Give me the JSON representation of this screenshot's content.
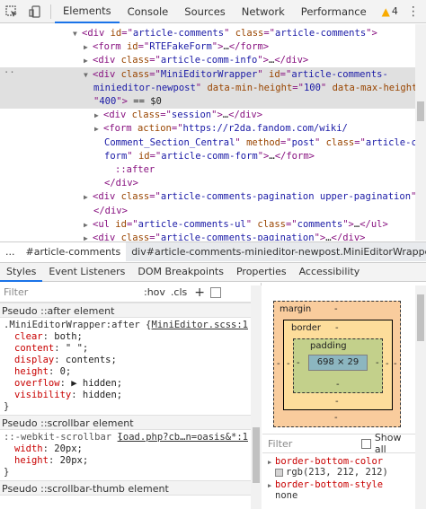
{
  "topbar": {
    "tabs": [
      "Elements",
      "Console",
      "Sources",
      "Network",
      "Performance"
    ],
    "active_tab": "Elements",
    "warning_count": "4"
  },
  "elements": {
    "lines": [
      {
        "indent": 1,
        "parts": [
          [
            "tri",
            "▼"
          ],
          [
            "tag",
            "<div "
          ],
          [
            "attr",
            "id"
          ],
          [
            "tag",
            "=\""
          ],
          [
            "val",
            "article-comments"
          ],
          [
            "tag",
            "\" "
          ],
          [
            "attr",
            "class"
          ],
          [
            "tag",
            "=\""
          ],
          [
            "val",
            "article-comments"
          ],
          [
            "tag",
            "\">"
          ]
        ]
      },
      {
        "indent": 2,
        "parts": [
          [
            "tri",
            "▶"
          ],
          [
            "tag",
            "<form "
          ],
          [
            "attr",
            "id"
          ],
          [
            "tag",
            "=\""
          ],
          [
            "val",
            "RTEFakeForm"
          ],
          [
            "tag",
            "\">"
          ],
          [
            "txt",
            "…"
          ],
          [
            "tag",
            "</form>"
          ]
        ]
      },
      {
        "indent": 2,
        "parts": [
          [
            "tri",
            "▶"
          ],
          [
            "tag",
            "<div "
          ],
          [
            "attr",
            "class"
          ],
          [
            "tag",
            "=\""
          ],
          [
            "val",
            "article-comm-info"
          ],
          [
            "tag",
            "\">"
          ],
          [
            "txt",
            "…"
          ],
          [
            "tag",
            "</div>"
          ]
        ]
      },
      {
        "indent": 2,
        "sel": true,
        "parts": [
          [
            "tri",
            "▼"
          ],
          [
            "tag",
            "<div "
          ],
          [
            "attr",
            "class"
          ],
          [
            "tag",
            "=\""
          ],
          [
            "val",
            "MiniEditorWrapper"
          ],
          [
            "tag",
            "\" "
          ],
          [
            "attr",
            "id"
          ],
          [
            "tag",
            "=\""
          ],
          [
            "val",
            "article-comments-"
          ]
        ]
      },
      {
        "indent": 0,
        "sel": true,
        "raw_indent": 104,
        "parts": [
          [
            "val",
            "minieditor-newpost"
          ],
          [
            "tag",
            "\" "
          ],
          [
            "attr",
            "data-min-height"
          ],
          [
            "tag",
            "=\""
          ],
          [
            "val",
            "100"
          ],
          [
            "tag",
            "\" "
          ],
          [
            "attr",
            "data-max-height"
          ],
          [
            "tag",
            "="
          ]
        ]
      },
      {
        "indent": 0,
        "sel": true,
        "raw_indent": 104,
        "parts": [
          [
            "tag",
            "\""
          ],
          [
            "val",
            "400"
          ],
          [
            "tag",
            "\">"
          ],
          [
            "txt",
            " == $0"
          ]
        ]
      },
      {
        "indent": 3,
        "parts": [
          [
            "tri",
            "▶"
          ],
          [
            "tag",
            "<div "
          ],
          [
            "attr",
            "class"
          ],
          [
            "tag",
            "=\""
          ],
          [
            "val",
            "session"
          ],
          [
            "tag",
            "\">"
          ],
          [
            "txt",
            "…"
          ],
          [
            "tag",
            "</div>"
          ]
        ]
      },
      {
        "indent": 3,
        "parts": [
          [
            "tri",
            "▶"
          ],
          [
            "tag",
            "<form "
          ],
          [
            "attr",
            "action"
          ],
          [
            "tag",
            "=\""
          ],
          [
            "val",
            "https://r2da.fandom.com/wiki/"
          ]
        ]
      },
      {
        "indent": 0,
        "raw_indent": 116,
        "parts": [
          [
            "val",
            "Comment_Section_Central"
          ],
          [
            "tag",
            "\" "
          ],
          [
            "attr",
            "method"
          ],
          [
            "tag",
            "=\""
          ],
          [
            "val",
            "post"
          ],
          [
            "tag",
            "\" "
          ],
          [
            "attr",
            "class"
          ],
          [
            "tag",
            "=\""
          ],
          [
            "val",
            "article-comm-"
          ]
        ]
      },
      {
        "indent": 0,
        "raw_indent": 116,
        "parts": [
          [
            "val",
            "form"
          ],
          [
            "tag",
            "\" "
          ],
          [
            "attr",
            "id"
          ],
          [
            "tag",
            "=\""
          ],
          [
            "val",
            "article-comm-form"
          ],
          [
            "tag",
            "\">"
          ],
          [
            "txt",
            "…"
          ],
          [
            "tag",
            "</form>"
          ]
        ]
      },
      {
        "indent": 4,
        "parts": [
          [
            "pseudo",
            "::after"
          ]
        ]
      },
      {
        "indent": 3,
        "parts": [
          [
            "tag",
            "</div>"
          ]
        ]
      },
      {
        "indent": 2,
        "parts": [
          [
            "tri",
            "▶"
          ],
          [
            "tag",
            "<div "
          ],
          [
            "attr",
            "class"
          ],
          [
            "tag",
            "=\""
          ],
          [
            "val",
            "article-comments-pagination upper-pagination"
          ],
          [
            "tag",
            "\">"
          ],
          [
            "txt",
            "…"
          ]
        ]
      },
      {
        "indent": 2,
        "parts": [
          [
            "tag",
            "</div>"
          ]
        ]
      },
      {
        "indent": 2,
        "parts": [
          [
            "tri",
            "▶"
          ],
          [
            "tag",
            "<ul "
          ],
          [
            "attr",
            "id"
          ],
          [
            "tag",
            "=\""
          ],
          [
            "val",
            "article-comments-ul"
          ],
          [
            "tag",
            "\" "
          ],
          [
            "attr",
            "class"
          ],
          [
            "tag",
            "=\""
          ],
          [
            "val",
            "comments"
          ],
          [
            "tag",
            "\">"
          ],
          [
            "txt",
            "…"
          ],
          [
            "tag",
            "</ul>"
          ]
        ]
      },
      {
        "indent": 2,
        "parts": [
          [
            "tri",
            "▶"
          ],
          [
            "tag",
            "<div "
          ],
          [
            "attr",
            "class"
          ],
          [
            "tag",
            "=\""
          ],
          [
            "val",
            "article-comments-pagination"
          ],
          [
            "tag",
            "\">"
          ],
          [
            "txt",
            "…"
          ],
          [
            "tag",
            "</div>"
          ]
        ]
      },
      {
        "indent": 1,
        "parts": [
          [
            "tag",
            "</div>"
          ]
        ]
      }
    ]
  },
  "breadcrumb": {
    "ellipsis": "...",
    "items": [
      "#article-comments",
      "div#article-comments-minieditor-newpost.MiniEditorWrapper"
    ]
  },
  "subtabs": [
    "Styles",
    "Event Listeners",
    "DOM Breakpoints",
    "Properties",
    "Accessibility"
  ],
  "styles": {
    "filter_placeholder": "Filter",
    "hov": ":hov",
    "cls": ".cls",
    "plus": "+",
    "sections": [
      {
        "header": "Pseudo ::after element",
        "selector": ".MiniEditorWrapper:after {",
        "source": "MiniEditor.scss:1",
        "props": [
          [
            "clear",
            "both;"
          ],
          [
            "content",
            "\" \";"
          ],
          [
            "display",
            "contents;"
          ],
          [
            "height",
            "0;"
          ],
          [
            "overflow",
            "▶ hidden;"
          ],
          [
            "visibility",
            "hidden;"
          ]
        ],
        "close": "}"
      },
      {
        "header": "Pseudo ::scrollbar element",
        "selector": "::-webkit-scrollbar {",
        "source": "load.php?cb…n=oasis&*:1",
        "props": [
          [
            "width",
            "20px;"
          ],
          [
            "height",
            "20px;"
          ]
        ],
        "close": "}"
      },
      {
        "header": "Pseudo ::scrollbar-thumb element",
        "selector": "",
        "source": "",
        "props": [],
        "close": ""
      }
    ]
  },
  "computed": {
    "box": {
      "margin_label": "margin",
      "margin_value": "-",
      "border_label": "border",
      "border_value": "-",
      "padding_label": "padding",
      "padding_value": "-",
      "content_size": "698 × 29",
      "dash": "-"
    },
    "filter_placeholder": "Filter",
    "show_all": "Show all",
    "props": [
      {
        "name": "border-bottom-color",
        "value": "rgb(213, 212, 212)",
        "swatch": "#d5d4d4"
      },
      {
        "name": "border-bottom-style",
        "value": "none"
      }
    ]
  }
}
